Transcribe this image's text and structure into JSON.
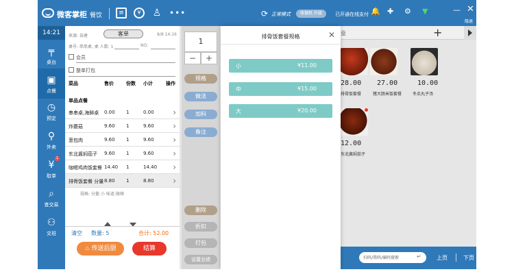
{
  "header": {
    "brand": "微客掌柜",
    "mode": "餐饮",
    "icons": [
      "document-icon",
      "coin-icon",
      "user-icon",
      "more-icon"
    ],
    "sync_mode": "正常模式",
    "pill_label": "收银机 升级",
    "online_label": "已开通在线支付",
    "right_note": "隐退"
  },
  "nav": {
    "clock": "14:21",
    "items": [
      {
        "label": "桌台",
        "icon": "table-icon"
      },
      {
        "label": "点餐",
        "icon": "order-icon"
      },
      {
        "label": "预定",
        "icon": "reserve-icon"
      },
      {
        "label": "外卖",
        "icon": "delivery-icon"
      },
      {
        "label": "取单",
        "icon": "pickup-icon",
        "badge": "1"
      },
      {
        "label": "查交易",
        "icon": "transactions-icon"
      },
      {
        "label": "交班",
        "icon": "shift-icon"
      }
    ]
  },
  "order": {
    "source_label": "来源: 自建",
    "tab": "客单",
    "date": "8/8 14:16",
    "table_row": "桌号: 串串桌, 桌  人数: 1",
    "no_label": "NO:",
    "member": "会员",
    "whole_pack": "整单打包",
    "headers": [
      "菜品",
      "售价",
      "份数",
      "小计",
      "操作"
    ],
    "section": "单品点餐",
    "rows": [
      {
        "name": "串串桌,海鲜桌",
        "price": "0.00",
        "qty": "1",
        "subtotal": "0.00"
      },
      {
        "name": "炸蘑菇",
        "price": "9.60",
        "qty": "1",
        "subtotal": "9.60"
      },
      {
        "name": "葱包肉",
        "price": "9.60",
        "qty": "1",
        "subtotal": "9.60"
      },
      {
        "name": "东北酱焖茄子",
        "price": "9.60",
        "qty": "1",
        "subtotal": "9.60"
      },
      {
        "name": "咖喱鸡肉饭套餐",
        "price": "14.40",
        "qty": "1",
        "subtotal": "14.40"
      },
      {
        "name": "排骨饭套餐 分量",
        "price": "8.80",
        "qty": "1",
        "subtotal": "8.80"
      }
    ],
    "row_note": "规格: 分量:小  味道:微辣",
    "clear": "清空",
    "count": "数量: 5",
    "total": "合计: 52.00",
    "send_kitchen": "传送后厨",
    "settle": "结算"
  },
  "middle": {
    "quantity": "1",
    "minus": "−",
    "plus": "+",
    "spec": "规格",
    "method": "做法",
    "extra": "加料",
    "note": "备注",
    "delete": "删除",
    "discount": "折扣",
    "pack": "打包",
    "set_performance": "设置业绩"
  },
  "dialog": {
    "title": "排骨饭套餐规格",
    "close": "✕",
    "options": [
      {
        "name": "小",
        "price": "¥11.00"
      },
      {
        "name": "中",
        "price": "¥15.00"
      },
      {
        "name": "大",
        "price": "¥20.00"
      }
    ]
  },
  "menu": {
    "top_label": "业",
    "add": "+",
    "dishes": [
      {
        "price": "28.00",
        "name": "排骨饭套餐"
      },
      {
        "price": "27.00",
        "name": "猪大肠米饭套餐"
      },
      {
        "price": "10.00",
        "name": "冬瓜丸子汤"
      },
      {
        "price": "12.00",
        "name": "东北酱焖茄子"
      }
    ],
    "search_placeholder": "扫码/简码/编码搜索",
    "prev": "上页",
    "next": "下页"
  }
}
